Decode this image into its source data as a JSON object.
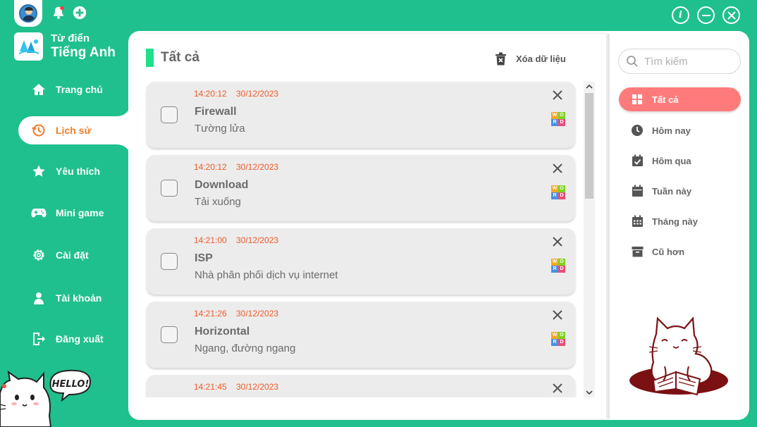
{
  "app": {
    "brand_line1": "Từ điển",
    "brand_line2": "Tiếng Anh"
  },
  "sidebar": {
    "items": [
      {
        "label": "Trang chủ",
        "icon": "home-icon",
        "active": false
      },
      {
        "label": "Lịch sử",
        "icon": "history-icon",
        "active": true
      },
      {
        "label": "Yêu thích",
        "icon": "star-icon",
        "active": false
      },
      {
        "label": "Mini game",
        "icon": "gamepad-icon",
        "active": false
      },
      {
        "label": "Cài đặt",
        "icon": "gear-icon",
        "active": false
      },
      {
        "label": "Tài khoản",
        "icon": "user-icon",
        "active": false
      },
      {
        "label": "Đăng xuất",
        "icon": "logout-icon",
        "active": false
      }
    ],
    "mascot_speech": "HELLO!"
  },
  "main": {
    "title": "Tất cả",
    "clear_label": "Xóa dữ liệu",
    "entries": [
      {
        "time": "14:20:12",
        "date": "30/12/2023",
        "word": "Firewall",
        "meaning": "Tường lửa"
      },
      {
        "time": "14:20:12",
        "date": "30/12/2023",
        "word": "Download",
        "meaning": "Tải xuống"
      },
      {
        "time": "14:21:00",
        "date": "30/12/2023",
        "word": "ISP",
        "meaning": "Nhà phân phối dịch vụ internet"
      },
      {
        "time": "14:21:26",
        "date": "30/12/2023",
        "word": "Horizontal",
        "meaning": "Ngang, đường ngang"
      },
      {
        "time": "14:21:45",
        "date": "30/12/2023",
        "word": "",
        "meaning": ""
      }
    ],
    "badge_letters": [
      "W",
      "O",
      "R",
      "D"
    ]
  },
  "filters": {
    "search_placeholder": "Tìm kiếm",
    "items": [
      {
        "label": "Tất cả",
        "icon": "grid-icon",
        "active": true
      },
      {
        "label": "Hôm nay",
        "icon": "clock-icon",
        "active": false
      },
      {
        "label": "Hôm qua",
        "icon": "calendar-check-icon",
        "active": false
      },
      {
        "label": "Tuần này",
        "icon": "calendar-icon",
        "active": false
      },
      {
        "label": "Tháng này",
        "icon": "calendar-grid-icon",
        "active": false
      },
      {
        "label": "Cũ hơn",
        "icon": "archive-icon",
        "active": false
      }
    ]
  },
  "colors": {
    "primary": "#1fc08d",
    "accent_orange": "#f07c2a",
    "timestamp": "#f05a28",
    "filter_active": "#ff7b7b",
    "title_marker": "#1ee08a"
  }
}
